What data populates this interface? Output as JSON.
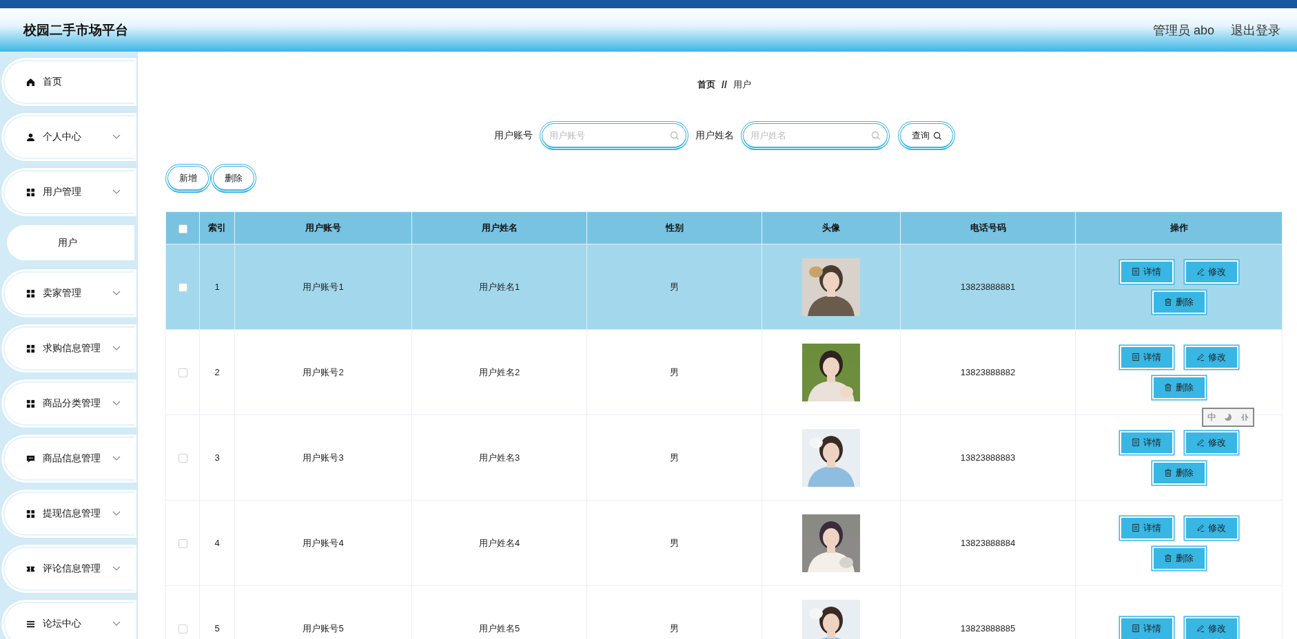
{
  "header": {
    "title": "校园二手市场平台",
    "user": "管理员 abo",
    "logout": "退出登录"
  },
  "sidebar": {
    "items": [
      {
        "label": "首页",
        "kind": "home",
        "has_submenu": false
      },
      {
        "label": "个人中心",
        "kind": "person",
        "has_submenu": true
      },
      {
        "label": "用户管理",
        "kind": "grid",
        "has_submenu": true,
        "children": [
          {
            "label": "用户"
          }
        ]
      },
      {
        "label": "卖家管理",
        "kind": "grid",
        "has_submenu": true
      },
      {
        "label": "求购信息管理",
        "kind": "grid",
        "has_submenu": true
      },
      {
        "label": "商品分类管理",
        "kind": "grid",
        "has_submenu": true
      },
      {
        "label": "商品信息管理",
        "kind": "chat",
        "has_submenu": true
      },
      {
        "label": "提现信息管理",
        "kind": "grid",
        "has_submenu": true
      },
      {
        "label": "评论信息管理",
        "kind": "ticket",
        "has_submenu": true
      },
      {
        "label": "论坛中心",
        "kind": "list",
        "has_submenu": true
      }
    ]
  },
  "breadcrumb": {
    "items": [
      "首页",
      "用户"
    ],
    "separator": "//"
  },
  "search": {
    "fields": [
      {
        "label": "用户账号",
        "placeholder": "用户账号"
      },
      {
        "label": "用户姓名",
        "placeholder": "用户姓名"
      }
    ],
    "button": "查询"
  },
  "actions": [
    "新增",
    "删除"
  ],
  "table": {
    "header_checked": false,
    "columns": [
      "索引",
      "用户账号",
      "用户姓名",
      "性别",
      "头像",
      "电话号码",
      "操作"
    ],
    "rows": [
      {
        "selected": true,
        "checked": false,
        "index": "1",
        "account": "用户账号1",
        "name": "用户姓名1",
        "gender": "男",
        "avatar": {
          "kind": "picture"
        },
        "phone": "13823888881",
        "buttons": [
          {
            "label": "详情",
            "kind": "detail"
          },
          {
            "label": "修改",
            "kind": "edit"
          },
          {
            "label": "删除",
            "kind": "delete"
          }
        ]
      },
      {
        "selected": false,
        "checked": false,
        "index": "2",
        "account": "用户账号2",
        "name": "用户姓名2",
        "gender": "男",
        "avatar": {
          "kind": "picture"
        },
        "phone": "13823888882",
        "buttons": [
          {
            "label": "详情",
            "kind": "detail"
          },
          {
            "label": "修改",
            "kind": "edit"
          },
          {
            "label": "删除",
            "kind": "delete"
          }
        ]
      },
      {
        "selected": false,
        "checked": false,
        "index": "3",
        "account": "用户账号3",
        "name": "用户姓名3",
        "gender": "男",
        "avatar": {
          "kind": "picture"
        },
        "phone": "13823888883",
        "buttons": [
          {
            "label": "详情",
            "kind": "detail"
          },
          {
            "label": "修改",
            "kind": "edit"
          },
          {
            "label": "删除",
            "kind": "delete"
          }
        ]
      },
      {
        "selected": false,
        "checked": false,
        "index": "4",
        "account": "用户账号4",
        "name": "用户姓名4",
        "gender": "男",
        "avatar": {
          "kind": "picture"
        },
        "phone": "13823888884",
        "buttons": [
          {
            "label": "详情",
            "kind": "detail"
          },
          {
            "label": "修改",
            "kind": "edit"
          },
          {
            "label": "删除",
            "kind": "delete"
          }
        ]
      },
      {
        "selected": false,
        "checked": false,
        "index": "5",
        "account": "用户账号5",
        "name": "用户姓名5",
        "gender": "男",
        "avatar": {
          "kind": "picture"
        },
        "phone": "13823888885",
        "buttons": [
          {
            "label": "详情",
            "kind": "detail"
          },
          {
            "label": "修改",
            "kind": "edit"
          }
        ]
      }
    ]
  },
  "ime_bar": {
    "mode": "中"
  }
}
